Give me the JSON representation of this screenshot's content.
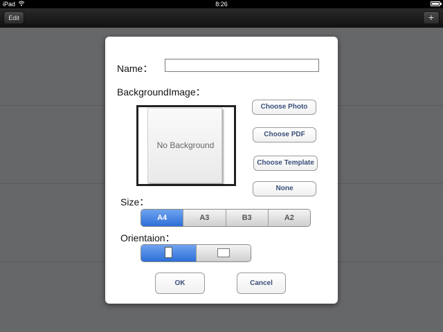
{
  "status_bar": {
    "carrier": "iPad",
    "time": "8:26"
  },
  "nav_bar": {
    "edit_label": "Edit",
    "add_label": "+"
  },
  "dialog": {
    "name_label": "Name：",
    "name_value": "",
    "background_label": "BackgroundImage：",
    "preview_text": "No Background",
    "buttons": {
      "choose_photo": "Choose Photo",
      "choose_pdf": "Choose PDF",
      "choose_template": "Choose Template",
      "none": "None"
    },
    "size_label": "Size：",
    "size_options": [
      "A4",
      "A3",
      "B3",
      "A2"
    ],
    "size_selected": "A4",
    "orientation_label": "Orientaion：",
    "orientation_selected": "portrait",
    "ok_label": "OK",
    "cancel_label": "Cancel"
  },
  "colors": {
    "accent": "#2d6fd8",
    "button_text": "#3a4f7a",
    "backdrop": "#666769"
  }
}
